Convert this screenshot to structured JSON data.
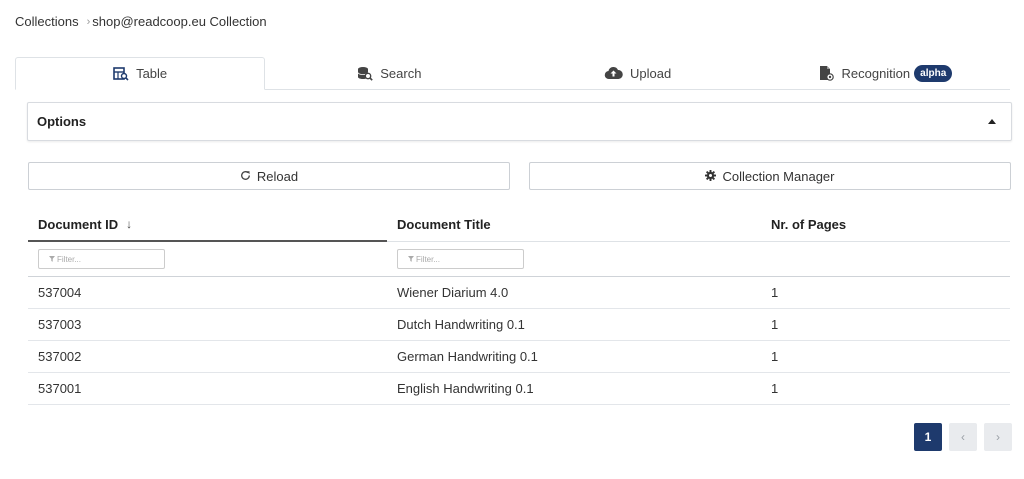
{
  "breadcrumb": {
    "root": "Collections",
    "separator": "›",
    "current": "shop@readcoop.eu Collection"
  },
  "tabs": [
    {
      "label": "Table",
      "icon": "table-search-icon",
      "active": true
    },
    {
      "label": "Search",
      "icon": "database-search-icon",
      "active": false
    },
    {
      "label": "Upload",
      "icon": "cloud-upload-icon",
      "active": false
    },
    {
      "label": "Recognition",
      "icon": "file-gear-icon",
      "active": false,
      "badge": "alpha"
    }
  ],
  "options": {
    "title": "Options",
    "expanded": true
  },
  "buttons": {
    "reload": "Reload",
    "collection_manager": "Collection Manager"
  },
  "table": {
    "columns": [
      "Document ID",
      "Document Title",
      "Nr. of Pages"
    ],
    "sort_indicator": "↓",
    "filter_placeholder": "Filter...",
    "rows": [
      {
        "id": "537004",
        "title": "Wiener Diarium 4.0",
        "pages": "1"
      },
      {
        "id": "537003",
        "title": "Dutch Handwriting 0.1",
        "pages": "1"
      },
      {
        "id": "537002",
        "title": "German Handwriting 0.1",
        "pages": "1"
      },
      {
        "id": "537001",
        "title": "English Handwriting 0.1",
        "pages": "1"
      }
    ]
  },
  "pagination": {
    "current": "1",
    "prev": "‹",
    "next": "›"
  },
  "colors": {
    "accent": "#1e3a6d",
    "border": "#dee2e6"
  }
}
